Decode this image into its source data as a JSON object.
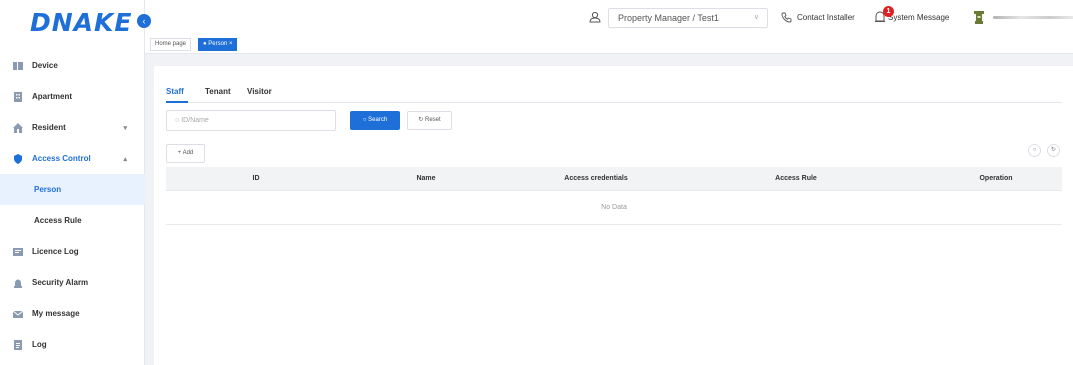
{
  "brand": {
    "logo": "DNAKE",
    "color": "#1f6fd8"
  },
  "sidebar": {
    "items": [
      {
        "label": "Device",
        "icon": "device-icon"
      },
      {
        "label": "Apartment",
        "icon": "building-icon"
      },
      {
        "label": "Resident",
        "icon": "home-icon",
        "expand": "▾"
      },
      {
        "label": "Access Control",
        "icon": "shield-icon",
        "expand": "▴"
      },
      {
        "label": "Person"
      },
      {
        "label": "Access Rule"
      },
      {
        "label": "Licence Log",
        "icon": "licence-icon"
      },
      {
        "label": "Security Alarm",
        "icon": "alarm-icon"
      },
      {
        "label": "My message",
        "icon": "mail-icon"
      },
      {
        "label": "Log",
        "icon": "log-icon"
      }
    ]
  },
  "header": {
    "role": "Property Manager / Test1",
    "contact": "Contact Installer",
    "system_message": "System Message",
    "badge": "1"
  },
  "tabs": {
    "home": "Home page",
    "current": "● Person ×"
  },
  "subtabs": [
    "Staff",
    "Tenant",
    "Visitor"
  ],
  "search": {
    "placeholder": "ID/Name",
    "search_label": "Search",
    "reset_label": "Reset",
    "add_label": "+ Add"
  },
  "table": {
    "columns": [
      "ID",
      "Name",
      "Access credentials",
      "Access Rule",
      "Operation"
    ],
    "empty": "No Data"
  }
}
